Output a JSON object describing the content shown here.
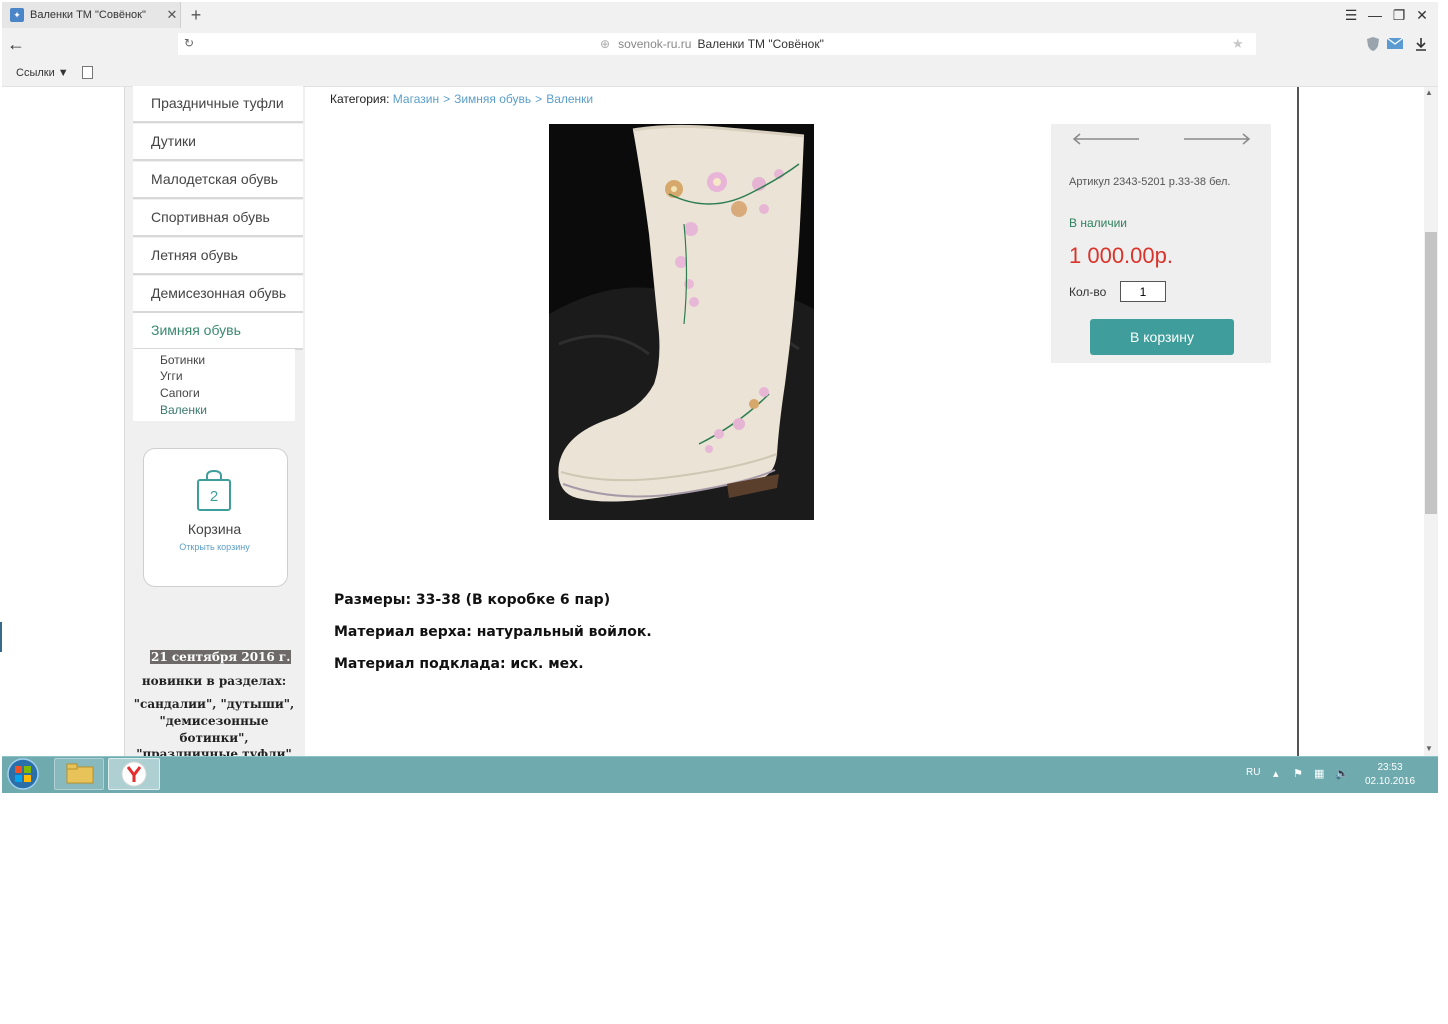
{
  "browser": {
    "tab_title": "Валенки ТМ \"Совёнок\"",
    "tab_close": "✕",
    "new_tab": "+",
    "window_buttons": [
      "☰",
      "—",
      "❐",
      "✕"
    ],
    "address_domain": "sovenok-ru.ru",
    "address_title": "Валенки ТМ \"Совёнок\"",
    "bookmarks_label": "Ссылки ▼"
  },
  "sidebar": {
    "menu": [
      {
        "label": "Праздничные туфли",
        "active": false
      },
      {
        "label": "Дутики",
        "active": false
      },
      {
        "label": "Малодетская обувь",
        "active": false
      },
      {
        "label": "Спортивная обувь",
        "active": false
      },
      {
        "label": "Летняя обувь",
        "active": false
      },
      {
        "label": "Демисезонная обувь",
        "active": false
      },
      {
        "label": "Зимняя обувь",
        "active": true
      }
    ],
    "submenu": [
      {
        "label": "Ботинки",
        "active": false
      },
      {
        "label": "Угги",
        "active": false
      },
      {
        "label": "Сапоги",
        "active": false
      },
      {
        "label": "Валенки",
        "active": true
      }
    ],
    "cart": {
      "count": "2",
      "title": "Корзина",
      "link": "Открыть корзину"
    },
    "news": {
      "date": "21 сентября 2016 г.",
      "lines": [
        "новинки в разделах:",
        "\"сандалии\", \"дутыши\",",
        "\"демисезонные",
        "ботинки\",",
        "\"праздничные туфли\""
      ]
    }
  },
  "breadcrumb": {
    "label": "Категория:",
    "items": [
      "Магазин",
      "Зимняя обувь",
      "Валенки"
    ],
    "separator": ">"
  },
  "product": {
    "sku": "Артикул 2343-5201 р.33-38 бел.",
    "availability": "В наличии",
    "price": "1 000.00р.",
    "qty_label": "Кол-во",
    "qty_value": "1",
    "add_to_cart": "В корзину",
    "description": [
      "Размеры: 33-38 (В коробке 6 пар)",
      "Материал верха: натуральный войлок.",
      "Материал подклада: иск. мех."
    ]
  },
  "taskbar": {
    "lang": "RU",
    "time": "23:53",
    "date": "02.10.2016"
  },
  "colors": {
    "accent_teal": "#3f9e9b",
    "price_red": "#d9342b",
    "link_blue": "#5b9ec9",
    "stock_green": "#2f7f5e",
    "taskbar": "#6eaaae"
  }
}
